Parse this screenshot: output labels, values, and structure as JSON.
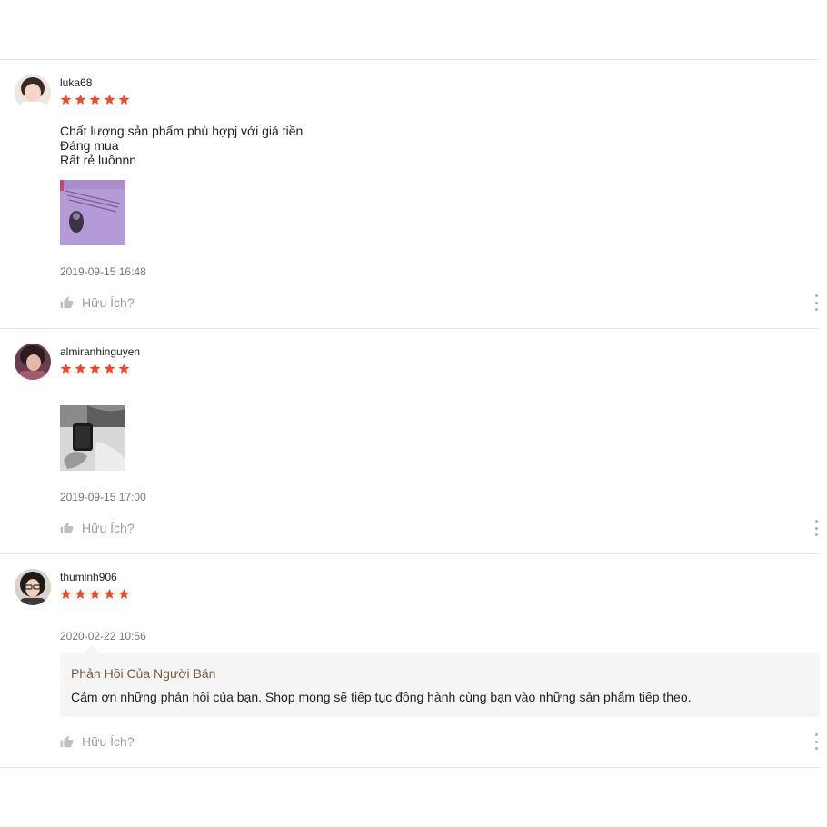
{
  "reviews": [
    {
      "username": "luka68",
      "rating": 5,
      "comment_lines": [
        "Chất lượng sản phẩm phù hợpj với giá tiền",
        "Đáng mua",
        "Rất rẻ luônnn"
      ],
      "timestamp": "2019-09-15 16:48",
      "helpful_label": "Hữu Ích?"
    },
    {
      "username": "almiranhinguyen",
      "rating": 5,
      "comment_lines": [],
      "timestamp": "2019-09-15 17:00",
      "helpful_label": "Hữu Ích?"
    },
    {
      "username": "thuminh906",
      "rating": 5,
      "comment_lines": [],
      "timestamp": "2020-02-22 10:56",
      "seller_reply": {
        "title": "Phản Hồi Của Người Bán",
        "text": "Cảm ơn những phản hồi của bạn. Shop mong sẽ tiếp tục đồng hành cùng bạn vào những sản phẩm tiếp theo."
      },
      "helpful_label": "Hữu Ích?"
    }
  ],
  "icons": {
    "star": "star-icon",
    "like": "thumbs-up-icon",
    "more": "more-vertical-icon"
  },
  "colors": {
    "star": "#ee4d2d",
    "reply_title": "#7b5a36",
    "muted": "#9e9e9e",
    "divider": "#e8e8e8",
    "reply_bg": "#f5f5f5"
  }
}
